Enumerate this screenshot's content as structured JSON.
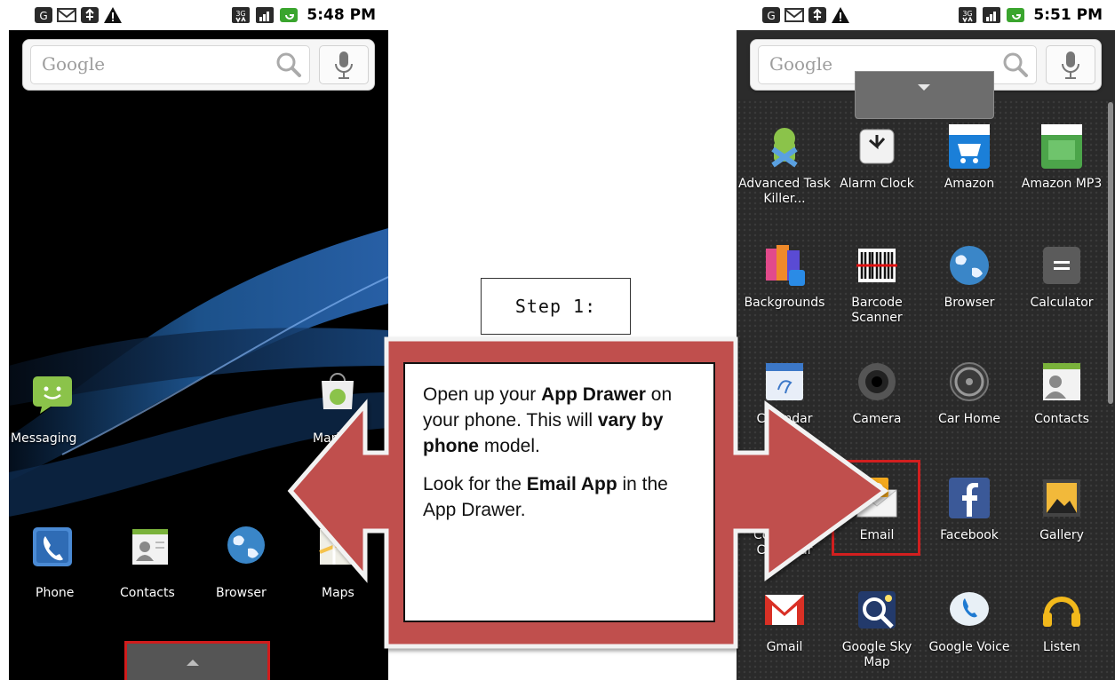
{
  "left_phone": {
    "time": "5:48 PM",
    "search_placeholder": "Google",
    "dock_items": [
      {
        "label": "Messaging",
        "icon": "messaging-icon"
      },
      {
        "label": "Market",
        "icon": "market-icon"
      }
    ],
    "home_items": [
      {
        "label": "Phone",
        "icon": "phone-icon"
      },
      {
        "label": "Contacts",
        "icon": "contacts-icon"
      },
      {
        "label": "Browser",
        "icon": "browser-icon"
      },
      {
        "label": "Maps",
        "icon": "maps-icon"
      }
    ],
    "tray_icon": "chevron-up-icon"
  },
  "right_phone": {
    "time": "5:51 PM",
    "search_placeholder": "Google",
    "apps": [
      {
        "label": "Advanced Task Killer...",
        "icon": "task-killer-icon"
      },
      {
        "label": "Alarm Clock",
        "icon": "alarm-clock-icon"
      },
      {
        "label": "Amazon",
        "icon": "amazon-icon"
      },
      {
        "label": "Amazon MP3",
        "icon": "amazon-mp3-icon"
      },
      {
        "label": "Backgrounds",
        "icon": "backgrounds-icon"
      },
      {
        "label": "Barcode Scanner",
        "icon": "barcode-icon"
      },
      {
        "label": "Browser",
        "icon": "browser-icon"
      },
      {
        "label": "Calculator",
        "icon": "calculator-icon"
      },
      {
        "label": "Calendar",
        "icon": "calendar-icon"
      },
      {
        "label": "Camera",
        "icon": "camera-icon"
      },
      {
        "label": "Car Home",
        "icon": "car-home-icon"
      },
      {
        "label": "Contacts",
        "icon": "contacts-icon"
      },
      {
        "label": "Corporate Calendar",
        "icon": "calendar-icon"
      },
      {
        "label": "Email",
        "icon": "email-icon"
      },
      {
        "label": "Facebook",
        "icon": "facebook-icon"
      },
      {
        "label": "Gallery",
        "icon": "gallery-icon"
      },
      {
        "label": "Gmail",
        "icon": "gmail-icon"
      },
      {
        "label": "Google Sky Map",
        "icon": "sky-map-icon"
      },
      {
        "label": "Google Voice",
        "icon": "voice-icon"
      },
      {
        "label": "Listen",
        "icon": "listen-icon"
      }
    ]
  },
  "step": {
    "title": "Step 1:",
    "p1_a": "Open up your ",
    "p1_b": "App Drawer",
    "p1_c": " on your phone. This will ",
    "p1_d": "vary by phone",
    "p1_e": " model.",
    "p2_a": "Look for the ",
    "p2_b": "Email App",
    "p2_c": " in the App Drawer."
  },
  "colors": {
    "arrow_fill": "#c0504d",
    "highlight": "#d21f1f",
    "wallpaper_blue": "#1f5a99"
  }
}
